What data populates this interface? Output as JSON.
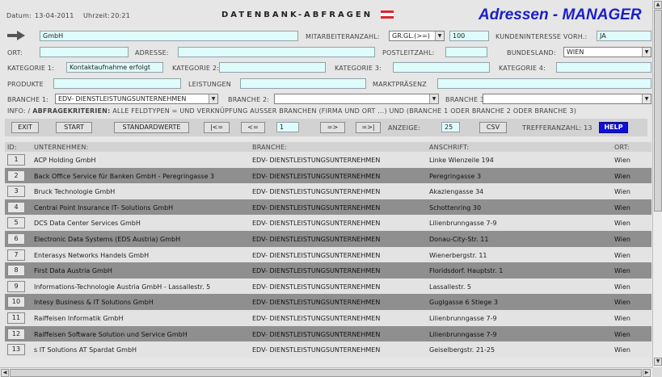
{
  "header": {
    "date_label": "Datum:",
    "date_value": "13-04-2011",
    "time_label": "Uhrzeit:",
    "time_value": "20:21",
    "title": "DATENBANK-ABFRAGEN",
    "brand": "Adressen - MANAGER"
  },
  "colors": {
    "brand": "#1a1ec8",
    "flag_red": "#e0242c",
    "help_button": "#1010d8",
    "input_bg": "#e0fbfb"
  },
  "search": {
    "company_value": "GmbH",
    "mitarbeiter_label": "MITARBEITERANZAHL:",
    "mitarbeiter_op": "GR.GL.(>=)",
    "mitarbeiter_value": "100",
    "kundeninteresse_label": "KUNDENINTERESSE VORH.:",
    "kundeninteresse_value": "JA",
    "ort_label": "ORT:",
    "ort_value": "",
    "adresse_label": "ADRESSE:",
    "adresse_value": "",
    "plz_label": "POSTLEITZAHL:",
    "plz_value": "",
    "bundesland_label": "BUNDESLAND:",
    "bundesland_value": "WIEN",
    "kat1_label": "KATEGORIE 1:",
    "kat1_value": "Kontaktaufnahme erfolgt",
    "kat2_label": "KATEGORIE 2:",
    "kat2_value": "",
    "kat3_label": "KATEGORIE 3:",
    "kat3_value": "",
    "kat4_label": "KATEGORIE 4:",
    "kat4_value": "",
    "produkte_label": "PRODUKTE",
    "produkte_value": "",
    "leistungen_label": "LEISTUNGEN",
    "leistungen_value": "",
    "markt_label": "MARKTPRÄSENZ",
    "markt_value": "",
    "branche1_label": "BRANCHE 1:",
    "branche1_value": "EDV- DIENSTLEISTUNGSUNTERNEHMEN",
    "branche2_label": "BRANCHE 2:",
    "branche2_value": "",
    "branche3_label": "BRANCHE 3:",
    "branche3_value": ""
  },
  "info": {
    "prefix": "INFO: /",
    "bold": "ABFRAGEKRITERIEN:",
    "text": "ALLE FELDTYPEN = UND VERKNÜPFUNG AUSSER BRANCHEN (FIRMA UND ORT ...) UND (BRANCHE 1 ODER BRANCHE 2 ODER BRANCHE 3)"
  },
  "toolbar": {
    "exit": "EXIT",
    "start": "START",
    "standardwerte": "STANDARDWERTE",
    "first": "|<=",
    "prev": "<=",
    "page_value": "1",
    "next": "=>",
    "last": "=>|",
    "anzeige_label": "ANZEIGE:",
    "anzeige_value": "25",
    "csv": "CSV",
    "treffer_label": "TREFFERANZAHL: 13",
    "help": "HELP"
  },
  "table": {
    "headers": {
      "id": "ID:",
      "company": "UNTERNEHMEN:",
      "branche": "BRANCHE:",
      "anschrift": "ANSCHRIFT:",
      "ort": "ORT:"
    },
    "rows": [
      {
        "id": "1",
        "company": "ACP Holding GmbH",
        "branche": "EDV- DIENSTLEISTUNGSUNTERNEHMEN",
        "anschrift": "Linke Wienzeile 194",
        "ort": "Wien"
      },
      {
        "id": "2",
        "company": "Back Office Service für Banken GmbH - Peregringasse 3",
        "branche": "EDV- DIENSTLEISTUNGSUNTERNEHMEN",
        "anschrift": "Peregringasse 3",
        "ort": "Wien"
      },
      {
        "id": "3",
        "company": "Bruck Technologie GmbH",
        "branche": "EDV- DIENSTLEISTUNGSUNTERNEHMEN",
        "anschrift": "Akaziengasse 34",
        "ort": "Wien"
      },
      {
        "id": "4",
        "company": "Central Point Insurance IT- Solutions GmbH",
        "branche": "EDV- DIENSTLEISTUNGSUNTERNEHMEN",
        "anschrift": "Schottenring 30",
        "ort": "Wien"
      },
      {
        "id": "5",
        "company": "DCS Data Center Services GmbH",
        "branche": "EDV- DIENSTLEISTUNGSUNTERNEHMEN",
        "anschrift": "Lilienbrunngasse 7-9",
        "ort": "Wien"
      },
      {
        "id": "6",
        "company": "Electronic Data Systems (EDS Austria) GmbH",
        "branche": "EDV- DIENSTLEISTUNGSUNTERNEHMEN",
        "anschrift": "Donau-City-Str. 11",
        "ort": "Wien"
      },
      {
        "id": "7",
        "company": "Enterasys Networks Handels GmbH",
        "branche": "EDV- DIENSTLEISTUNGSUNTERNEHMEN",
        "anschrift": "Wienerbergstr. 11",
        "ort": "Wien"
      },
      {
        "id": "8",
        "company": "First Data Austria GmbH",
        "branche": "EDV- DIENSTLEISTUNGSUNTERNEHMEN",
        "anschrift": "Floridsdorf. Hauptstr. 1",
        "ort": "Wien"
      },
      {
        "id": "9",
        "company": "Informations-Technologie Austria GmbH - Lassallestr. 5",
        "branche": "EDV- DIENSTLEISTUNGSUNTERNEHMEN",
        "anschrift": "Lassallestr. 5",
        "ort": "Wien"
      },
      {
        "id": "10",
        "company": "Intesy Business & IT Solutions GmbH",
        "branche": "EDV- DIENSTLEISTUNGSUNTERNEHMEN",
        "anschrift": "Guglgasse 6 Stiege 3",
        "ort": "Wien"
      },
      {
        "id": "11",
        "company": "Raiffeisen Informatik GmbH",
        "branche": "EDV- DIENSTLEISTUNGSUNTERNEHMEN",
        "anschrift": "Lilienbrunngasse 7-9",
        "ort": "Wien"
      },
      {
        "id": "12",
        "company": "Raiffeisen Software Solution und Service GmbH",
        "branche": "EDV- DIENSTLEISTUNGSUNTERNEHMEN",
        "anschrift": "Lilienbrunngasse 7-9",
        "ort": "Wien"
      },
      {
        "id": "13",
        "company": "s IT Solutions AT Spardat GmbH",
        "branche": "EDV- DIENSTLEISTUNGSUNTERNEHMEN",
        "anschrift": "Geiselbergstr. 21-25",
        "ort": "Wien"
      }
    ]
  }
}
